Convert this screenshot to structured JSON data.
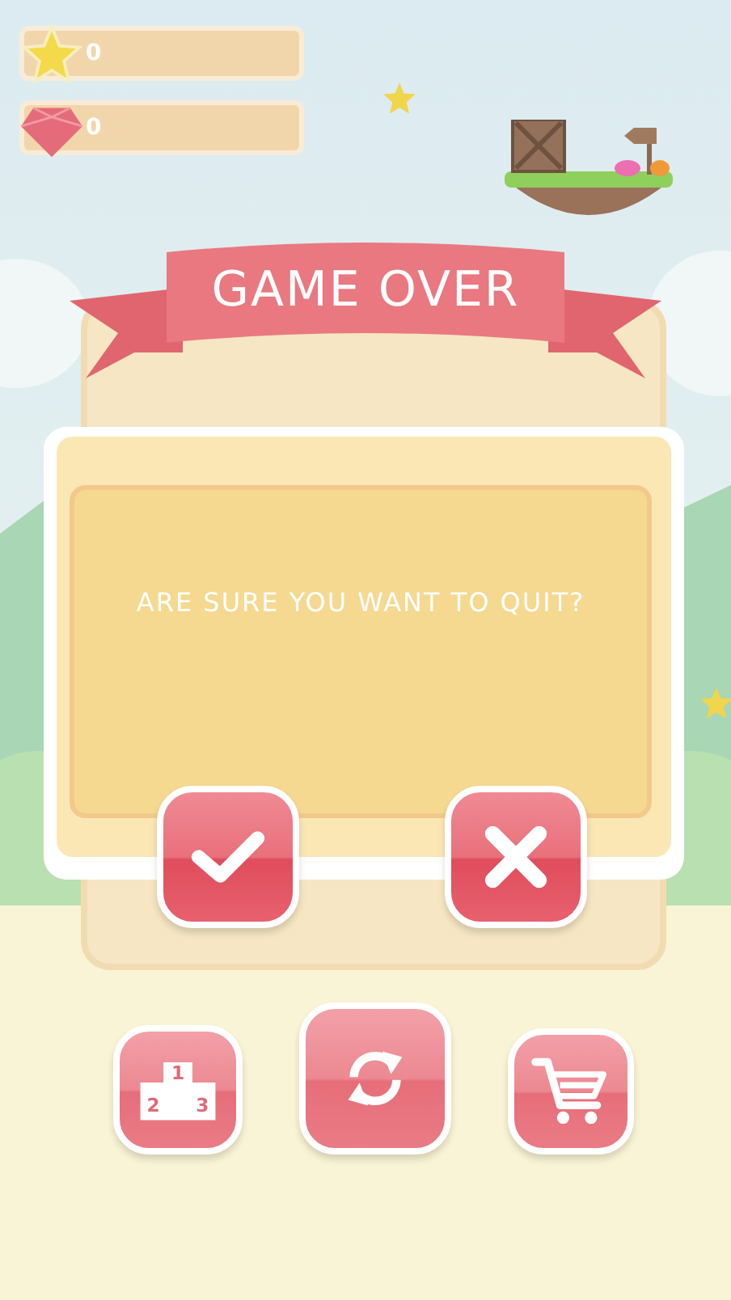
{
  "hud": {
    "stars": "0",
    "gems": "0"
  },
  "banner": {
    "title": "GAME OVER"
  },
  "dialog": {
    "message": "ARE SURE YOU WANT TO QUIT?",
    "buttons": [
      {
        "kind": "confirm"
      },
      {
        "kind": "cancel"
      }
    ]
  },
  "menu_buttons": [
    {
      "kind": "leaderboard",
      "ranks": [
        "1",
        "2",
        "3"
      ]
    },
    {
      "kind": "restart"
    },
    {
      "kind": "shop"
    }
  ]
}
